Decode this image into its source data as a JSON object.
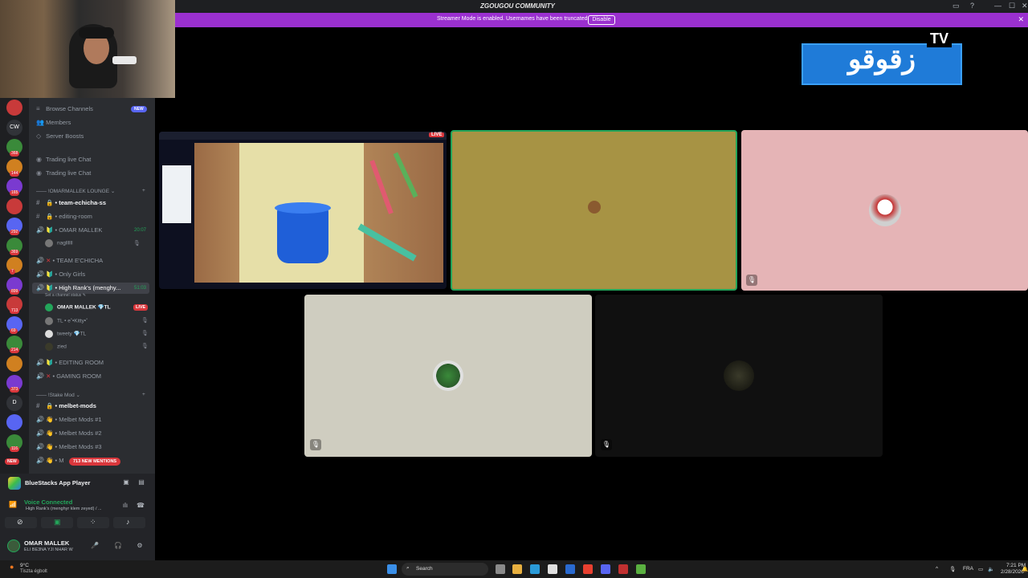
{
  "window": {
    "title": "ZGOUGOU COMMUNITY",
    "controls": [
      "—",
      "☐",
      "✕"
    ]
  },
  "streamer_banner": {
    "message": "Streamer Mode is enabled. Usernames have been truncated.",
    "button": "Disable"
  },
  "servers": [
    {
      "label": "",
      "badge": ""
    },
    {
      "label": "CW",
      "badge": ""
    },
    {
      "label": "",
      "badge": "368"
    },
    {
      "label": "",
      "badge": "144"
    },
    {
      "label": "",
      "badge": "165"
    },
    {
      "label": "",
      "badge": ""
    },
    {
      "label": "",
      "badge": "292"
    },
    {
      "label": "",
      "badge": "369"
    },
    {
      "label": "",
      "badge": "7"
    },
    {
      "label": "",
      "badge": "899"
    },
    {
      "label": "",
      "badge": "713"
    },
    {
      "label": "",
      "badge": "69"
    },
    {
      "label": "",
      "badge": "214"
    },
    {
      "label": "",
      "badge": ""
    },
    {
      "label": "",
      "badge": "373"
    },
    {
      "label": "D",
      "badge": ""
    },
    {
      "label": "",
      "badge": ""
    },
    {
      "label": "",
      "badge": "116"
    }
  ],
  "new_badge": "NEW",
  "sidebar": {
    "browse_channels": "Browse Channels",
    "browse_new": "NEW",
    "members": "Members",
    "server_boosts": "Server Boosts",
    "trading_live_chat_1": "Trading live Chat",
    "trading_live_chat_2": "Trading live Chat",
    "category_1": "!OMARMALLEK LOUNGE",
    "team_echicha": "team-echicha-ss",
    "editing_room_text": "editing-room",
    "omar_mallek_voice": "OMAR MALLEK",
    "omar_mallek_time": "20:07",
    "omar_user": "nagllllll",
    "team_echicha_voice": "TEAM E'CHICHA",
    "only_girls": "Only Girls",
    "high_ranks": "High Rank's (menghy...",
    "high_ranks_time": "51:03",
    "channel_status": "Set a channel status",
    "vu_omar": "OMAR MALLEK",
    "vu_omar_tag": "TL",
    "vu_omar_live": "LIVE",
    "vu_kitty": "TL • e˚•Kitty•˚",
    "vu_tweety": "tweety",
    "vu_tweety_tag": "TL",
    "vu_zied": "zied",
    "editing_room_voice": "EDITING ROOM",
    "gaming_room": "GAMING ROOM",
    "category_2": "!Stake Mod",
    "melbet_mods": "melbet-mods",
    "melbet_1": "Melbet Mods #1",
    "melbet_2": "Melbet Mods #2",
    "melbet_3": "Melbet Mods #3",
    "melbet_4": "M"
  },
  "new_mentions": "713 NEW MENTIONS",
  "bottom": {
    "app_name": "BlueStacks App Player",
    "voice_status": "Voice Connected",
    "voice_channel": "High Rank's (menghyr klem zeyed) / ...",
    "user_name": "OMAR MALLEK",
    "user_status": "ELI BE3NA YJI NHAR W"
  },
  "stage": {
    "live_label": "LIVE",
    "tv_logo_text": "زقوقو",
    "tv_label": "TV"
  },
  "taskbar": {
    "weather_temp": "9°C",
    "weather_desc": "Tiszta égbolt",
    "search": "Search",
    "lang": "FRA",
    "time": "7:21 PM",
    "date": "2/28/2026"
  },
  "colors": {
    "banner": "#9b30d0",
    "tile_olive": "#a79344",
    "tile_pink": "#e5b4b6",
    "tile_grey": "#cfcdc0",
    "tile_dark": "#101010",
    "speaking_border": "#23a55a"
  }
}
